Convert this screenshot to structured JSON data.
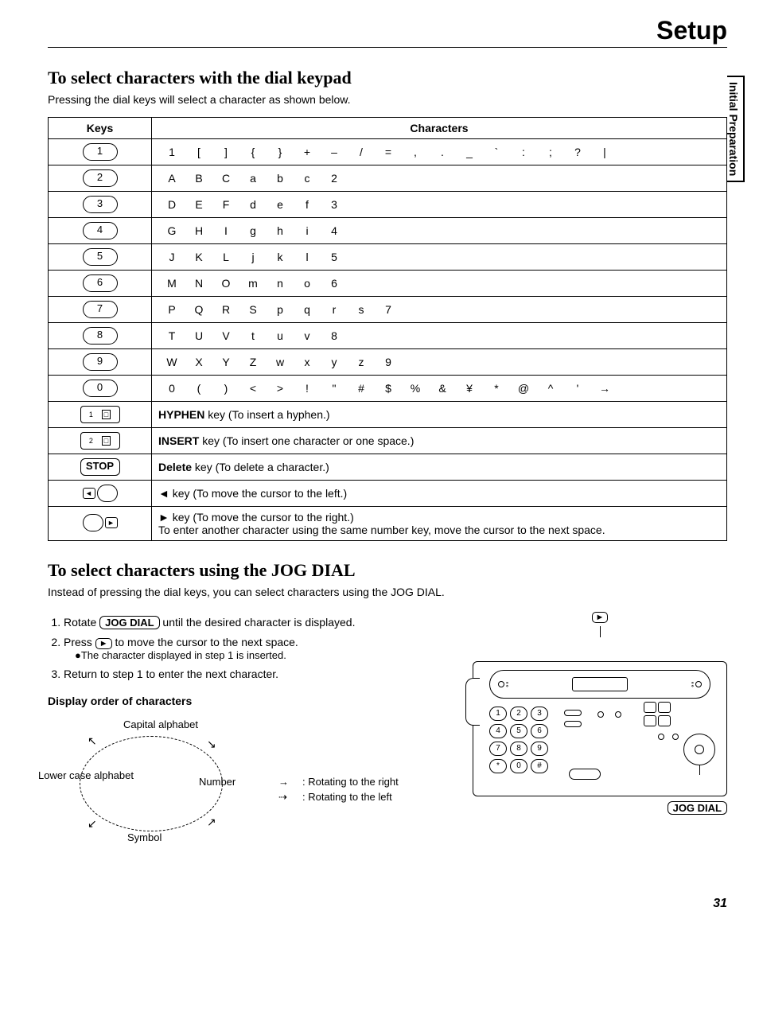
{
  "header": "Setup",
  "side_tab": "Initial Preparation",
  "section1": {
    "title": "To select characters with the dial keypad",
    "intro": "Pressing the dial keys will select a character as shown below.",
    "th_keys": "Keys",
    "th_chars": "Characters",
    "rows": [
      {
        "key": "1",
        "chars": [
          "1",
          "[",
          "]",
          "{",
          "}",
          "+",
          "–",
          "/",
          "=",
          ",",
          ".",
          "_",
          "`",
          ":",
          ";",
          "?",
          "|"
        ]
      },
      {
        "key": "2",
        "chars": [
          "A",
          "B",
          "C",
          "a",
          "b",
          "c",
          "2"
        ]
      },
      {
        "key": "3",
        "chars": [
          "D",
          "E",
          "F",
          "d",
          "e",
          "f",
          "3"
        ]
      },
      {
        "key": "4",
        "chars": [
          "G",
          "H",
          "I",
          "g",
          "h",
          "i",
          "4"
        ]
      },
      {
        "key": "5",
        "chars": [
          "J",
          "K",
          "L",
          "j",
          "k",
          "l",
          "5"
        ]
      },
      {
        "key": "6",
        "chars": [
          "M",
          "N",
          "O",
          "m",
          "n",
          "o",
          "6"
        ]
      },
      {
        "key": "7",
        "chars": [
          "P",
          "Q",
          "R",
          "S",
          "p",
          "q",
          "r",
          "s",
          "7"
        ]
      },
      {
        "key": "8",
        "chars": [
          "T",
          "U",
          "V",
          "t",
          "u",
          "v",
          "8"
        ]
      },
      {
        "key": "9",
        "chars": [
          "W",
          "X",
          "Y",
          "Z",
          "w",
          "x",
          "y",
          "z",
          "9"
        ]
      },
      {
        "key": "0",
        "chars": [
          "0",
          "(",
          ")",
          "<",
          ">",
          "!",
          "\"",
          "#",
          "$",
          "%",
          "&",
          "¥",
          "*",
          "@",
          "^",
          "'",
          "→"
        ]
      }
    ],
    "desc_rows": [
      {
        "icon": "hyphen-key",
        "label_bold": "HYPHEN",
        "label_rest": " key (To insert a hyphen.)"
      },
      {
        "icon": "insert-key",
        "label_bold": "INSERT",
        "label_rest": " key (To insert one character or one space.)"
      },
      {
        "icon": "stop-key",
        "label_bold": "Delete",
        "label_rest": " key (To delete a character.)"
      },
      {
        "icon": "left-key",
        "label_bold": "◄",
        "label_rest": " key (To move the cursor to the left.)"
      },
      {
        "icon": "right-key",
        "label_bold": "►",
        "label_rest": " key (To move the cursor to the right.)\nTo enter another character using the same number key, move the cursor to the next space."
      }
    ]
  },
  "section2": {
    "title": "To select characters using the JOG DIAL",
    "intro": "Instead of pressing the dial keys, you can select characters using the JOG DIAL.",
    "steps": [
      {
        "pre": "Rotate ",
        "box": "JOG DIAL",
        "post": " until the desired character is displayed."
      },
      {
        "pre": "Press ",
        "box": "►",
        "post": " to move the cursor to the next space.",
        "sub": "●The character displayed in step 1 is inserted."
      },
      {
        "pre": "Return to step 1 to enter the next character.",
        "box": "",
        "post": ""
      }
    ],
    "subhead": "Display order of characters",
    "cycle": {
      "top": "Capital\nalphabet",
      "left": "Lower case\nalphabet",
      "right": "Number",
      "bottom": "Symbol"
    },
    "legend": {
      "right": ": Rotating to the right",
      "left": ": Rotating to the left"
    },
    "device": {
      "jog_label": "JOG DIAL",
      "keypad": [
        "1",
        "2",
        "3",
        "4",
        "5",
        "6",
        "7",
        "8",
        "9",
        "*",
        "0",
        "#"
      ]
    }
  },
  "page_number": "31"
}
